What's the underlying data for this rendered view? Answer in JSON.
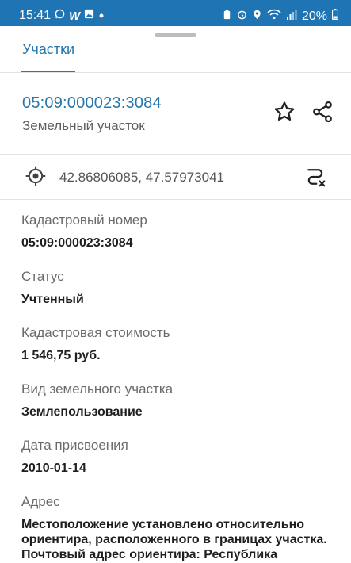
{
  "status_bar": {
    "time": "15:41",
    "battery": "20%",
    "colors": {
      "background": "#1f74b4",
      "text": "#ffffff"
    },
    "icons": [
      "whatsapp-icon",
      "w-app-icon",
      "gallery-icon",
      "dot-icon",
      "battery-saver-icon",
      "alarm-icon",
      "location-icon",
      "wifi-icon",
      "signal-icon",
      "battery-icon"
    ]
  },
  "tab": {
    "label": "Участки"
  },
  "parcel": {
    "number": "05:09:000023:3084",
    "type": "Земельный участок"
  },
  "coordinates": {
    "text": "42.86806085, 47.57973041"
  },
  "fields": [
    {
      "label": "Кадастровый номер",
      "value": "05:09:000023:3084"
    },
    {
      "label": "Статус",
      "value": "Учтенный"
    },
    {
      "label": "Кадастровая стоимость",
      "value": "1 546,75 руб."
    },
    {
      "label": "Вид земельного участка",
      "value": "Землепользование"
    },
    {
      "label": "Дата присвоения",
      "value": "2010-01-14"
    },
    {
      "label": "Адрес",
      "value": "Местоположение установлено относительно ориентира, расположенного в границах участка. Почтовый адрес ориентира: Республика"
    }
  ],
  "colors": {
    "accent": "#2776ae",
    "label": "#6a6a6a",
    "value": "#1f1f1f"
  }
}
